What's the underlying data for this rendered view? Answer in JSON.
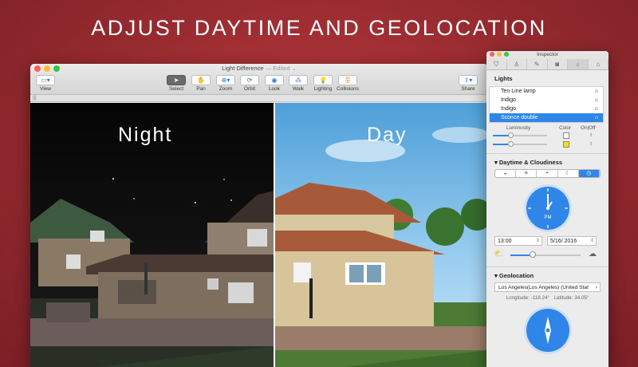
{
  "headline": "ADJUST DAYTIME AND GEOLOCATION",
  "window": {
    "title": "Light Difference",
    "title_suffix": "— Edited ⌄",
    "toolbar": {
      "view": "View",
      "select": "Select",
      "pan": "Pan",
      "zoom": "Zoom",
      "orbit": "Orbit",
      "look": "Look",
      "walk": "Walk",
      "lighting": "Lighting",
      "collisions": "Collisions",
      "share": "Share"
    },
    "scene": {
      "night_label": "Night",
      "day_label": "Day"
    }
  },
  "inspector": {
    "title": "Inspector",
    "lights_header": "Lights",
    "lights": [
      {
        "name": "Ten Line lamp"
      },
      {
        "name": "Indigo"
      },
      {
        "name": "Indigo"
      },
      {
        "name": "Sconce double"
      }
    ],
    "columns": {
      "luminosity": "Luminosity",
      "color": "Color",
      "onoff": "On|Off"
    },
    "daytime_header": "Daytime & Cloudiness",
    "clock_ampm": "PM",
    "time": "13:00",
    "date": "5/16/ 2016",
    "geolocation_header": "Geolocation",
    "location": "Los Angeles(Los Angeles) (United Stat",
    "longitude": "Longitude: -118.24°",
    "latitude": "Latitude: 34.05°"
  },
  "colors": {
    "background": "#952a2f",
    "accent": "#2f86e8",
    "swatch_white": "#ffffff",
    "swatch_yellow": "#f2e318"
  },
  "icons": [
    "sun-icon",
    "cloud-icon",
    "compass-icon",
    "bulb-icon",
    "lamp-icon"
  ]
}
